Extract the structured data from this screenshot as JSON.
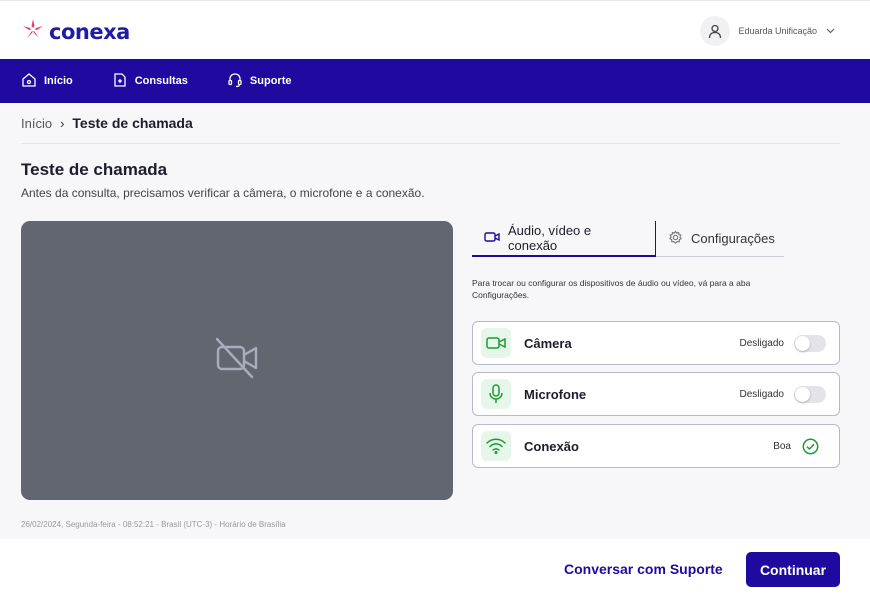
{
  "brand": {
    "name": "conexa",
    "accent": "#1f0aa0",
    "logo_mark_color": "#ef3b6a"
  },
  "user": {
    "name": "Eduarda Unificação",
    "icon": "user-icon",
    "menu_icon": "chevron-down-icon"
  },
  "nav": {
    "items": [
      {
        "label": "Início",
        "icon": "home-icon"
      },
      {
        "label": "Consultas",
        "icon": "file-icon"
      },
      {
        "label": "Suporte",
        "icon": "headset-icon"
      }
    ]
  },
  "breadcrumb": {
    "home": "Início",
    "separator": "›",
    "current": "Teste de chamada"
  },
  "page": {
    "title": "Teste de chamada",
    "subtitle": "Antes da consulta, precisamos verificar a câmera, o microfone e a conexão."
  },
  "video": {
    "icon": "video-off-icon",
    "background": "#626671"
  },
  "tabs": [
    {
      "label": "Áudio, vídeo e conexão",
      "icon": "video-icon",
      "active": true
    },
    {
      "label": "Configurações",
      "icon": "gear-icon",
      "active": false
    }
  ],
  "info_text": "Para trocar ou configurar os dispositivos de áudio ou vídeo, vá para a aba Configurações.",
  "devices": [
    {
      "label": "Câmera",
      "status": "Desligado",
      "icon": "camera-icon",
      "control": "toggle",
      "on": false
    },
    {
      "label": "Microfone",
      "status": "Desligado",
      "icon": "microphone-icon",
      "control": "toggle",
      "on": false
    },
    {
      "label": "Conexão",
      "status": "Boa",
      "icon": "wifi-icon",
      "control": "check"
    }
  ],
  "status_color_ok": "#1e9a3a",
  "timestamp": "26/02/2024, Segunda-feira - 08:52:21 - Brasil (UTC-3) - Horário de Brasília",
  "footer": {
    "support_button": "Conversar com Suporte",
    "continue_button": "Continuar"
  }
}
